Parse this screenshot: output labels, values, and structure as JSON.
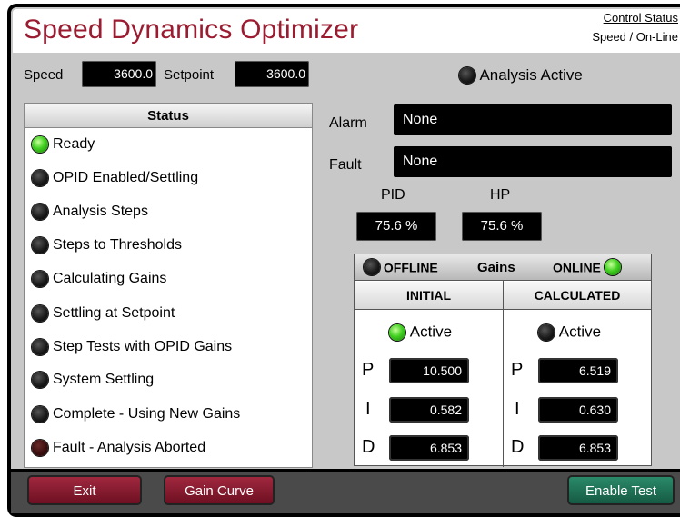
{
  "app": {
    "title": "Speed Dynamics Optimizer",
    "control_status_link": "Control Status",
    "control_status_value": "Speed / On-Line"
  },
  "readouts": {
    "speed_label": "Speed",
    "speed_value": "3600.0",
    "setpoint_label": "Setpoint",
    "setpoint_value": "3600.0"
  },
  "analysis": {
    "label": "Analysis  Active",
    "led": "off"
  },
  "status": {
    "header": "Status",
    "items": [
      {
        "label": "Ready",
        "led": "green"
      },
      {
        "label": "OPID Enabled/Settling",
        "led": "off"
      },
      {
        "label": "Analysis Steps",
        "led": "off"
      },
      {
        "label": "Steps to Thresholds",
        "led": "off"
      },
      {
        "label": "Calculating Gains",
        "led": "off"
      },
      {
        "label": "Settling at Setpoint",
        "led": "off"
      },
      {
        "label": "Step Tests with OPID Gains",
        "led": "off"
      },
      {
        "label": "System Settling",
        "led": "off"
      },
      {
        "label": "Complete - Using New Gains",
        "led": "off"
      },
      {
        "label": "Fault - Analysis Aborted",
        "led": "red-off"
      }
    ]
  },
  "alarm": {
    "label": "Alarm",
    "value": "None"
  },
  "fault": {
    "label": "Fault",
    "value": "None"
  },
  "pid": {
    "label": "PID",
    "value": "75.6 %"
  },
  "hp": {
    "label": "HP",
    "value": "75.6 %"
  },
  "gains": {
    "offline_label": "OFFLINE",
    "title": "Gains",
    "online_label": "ONLINE",
    "offline_led": "off",
    "online_led": "green",
    "initial": {
      "header": "INITIAL",
      "active_label": "Active",
      "active_led": "green",
      "p": "10.500",
      "i": "0.582",
      "d": "6.853"
    },
    "calculated": {
      "header": "CALCULATED",
      "active_label": "Active",
      "active_led": "off",
      "p": "6.519",
      "i": "0.630",
      "d": "6.853"
    },
    "p_label": "P",
    "i_label": "I",
    "d_label": "D"
  },
  "buttons": {
    "exit": "Exit",
    "gain_curve": "Gain Curve",
    "enable_test": "Enable Test"
  }
}
